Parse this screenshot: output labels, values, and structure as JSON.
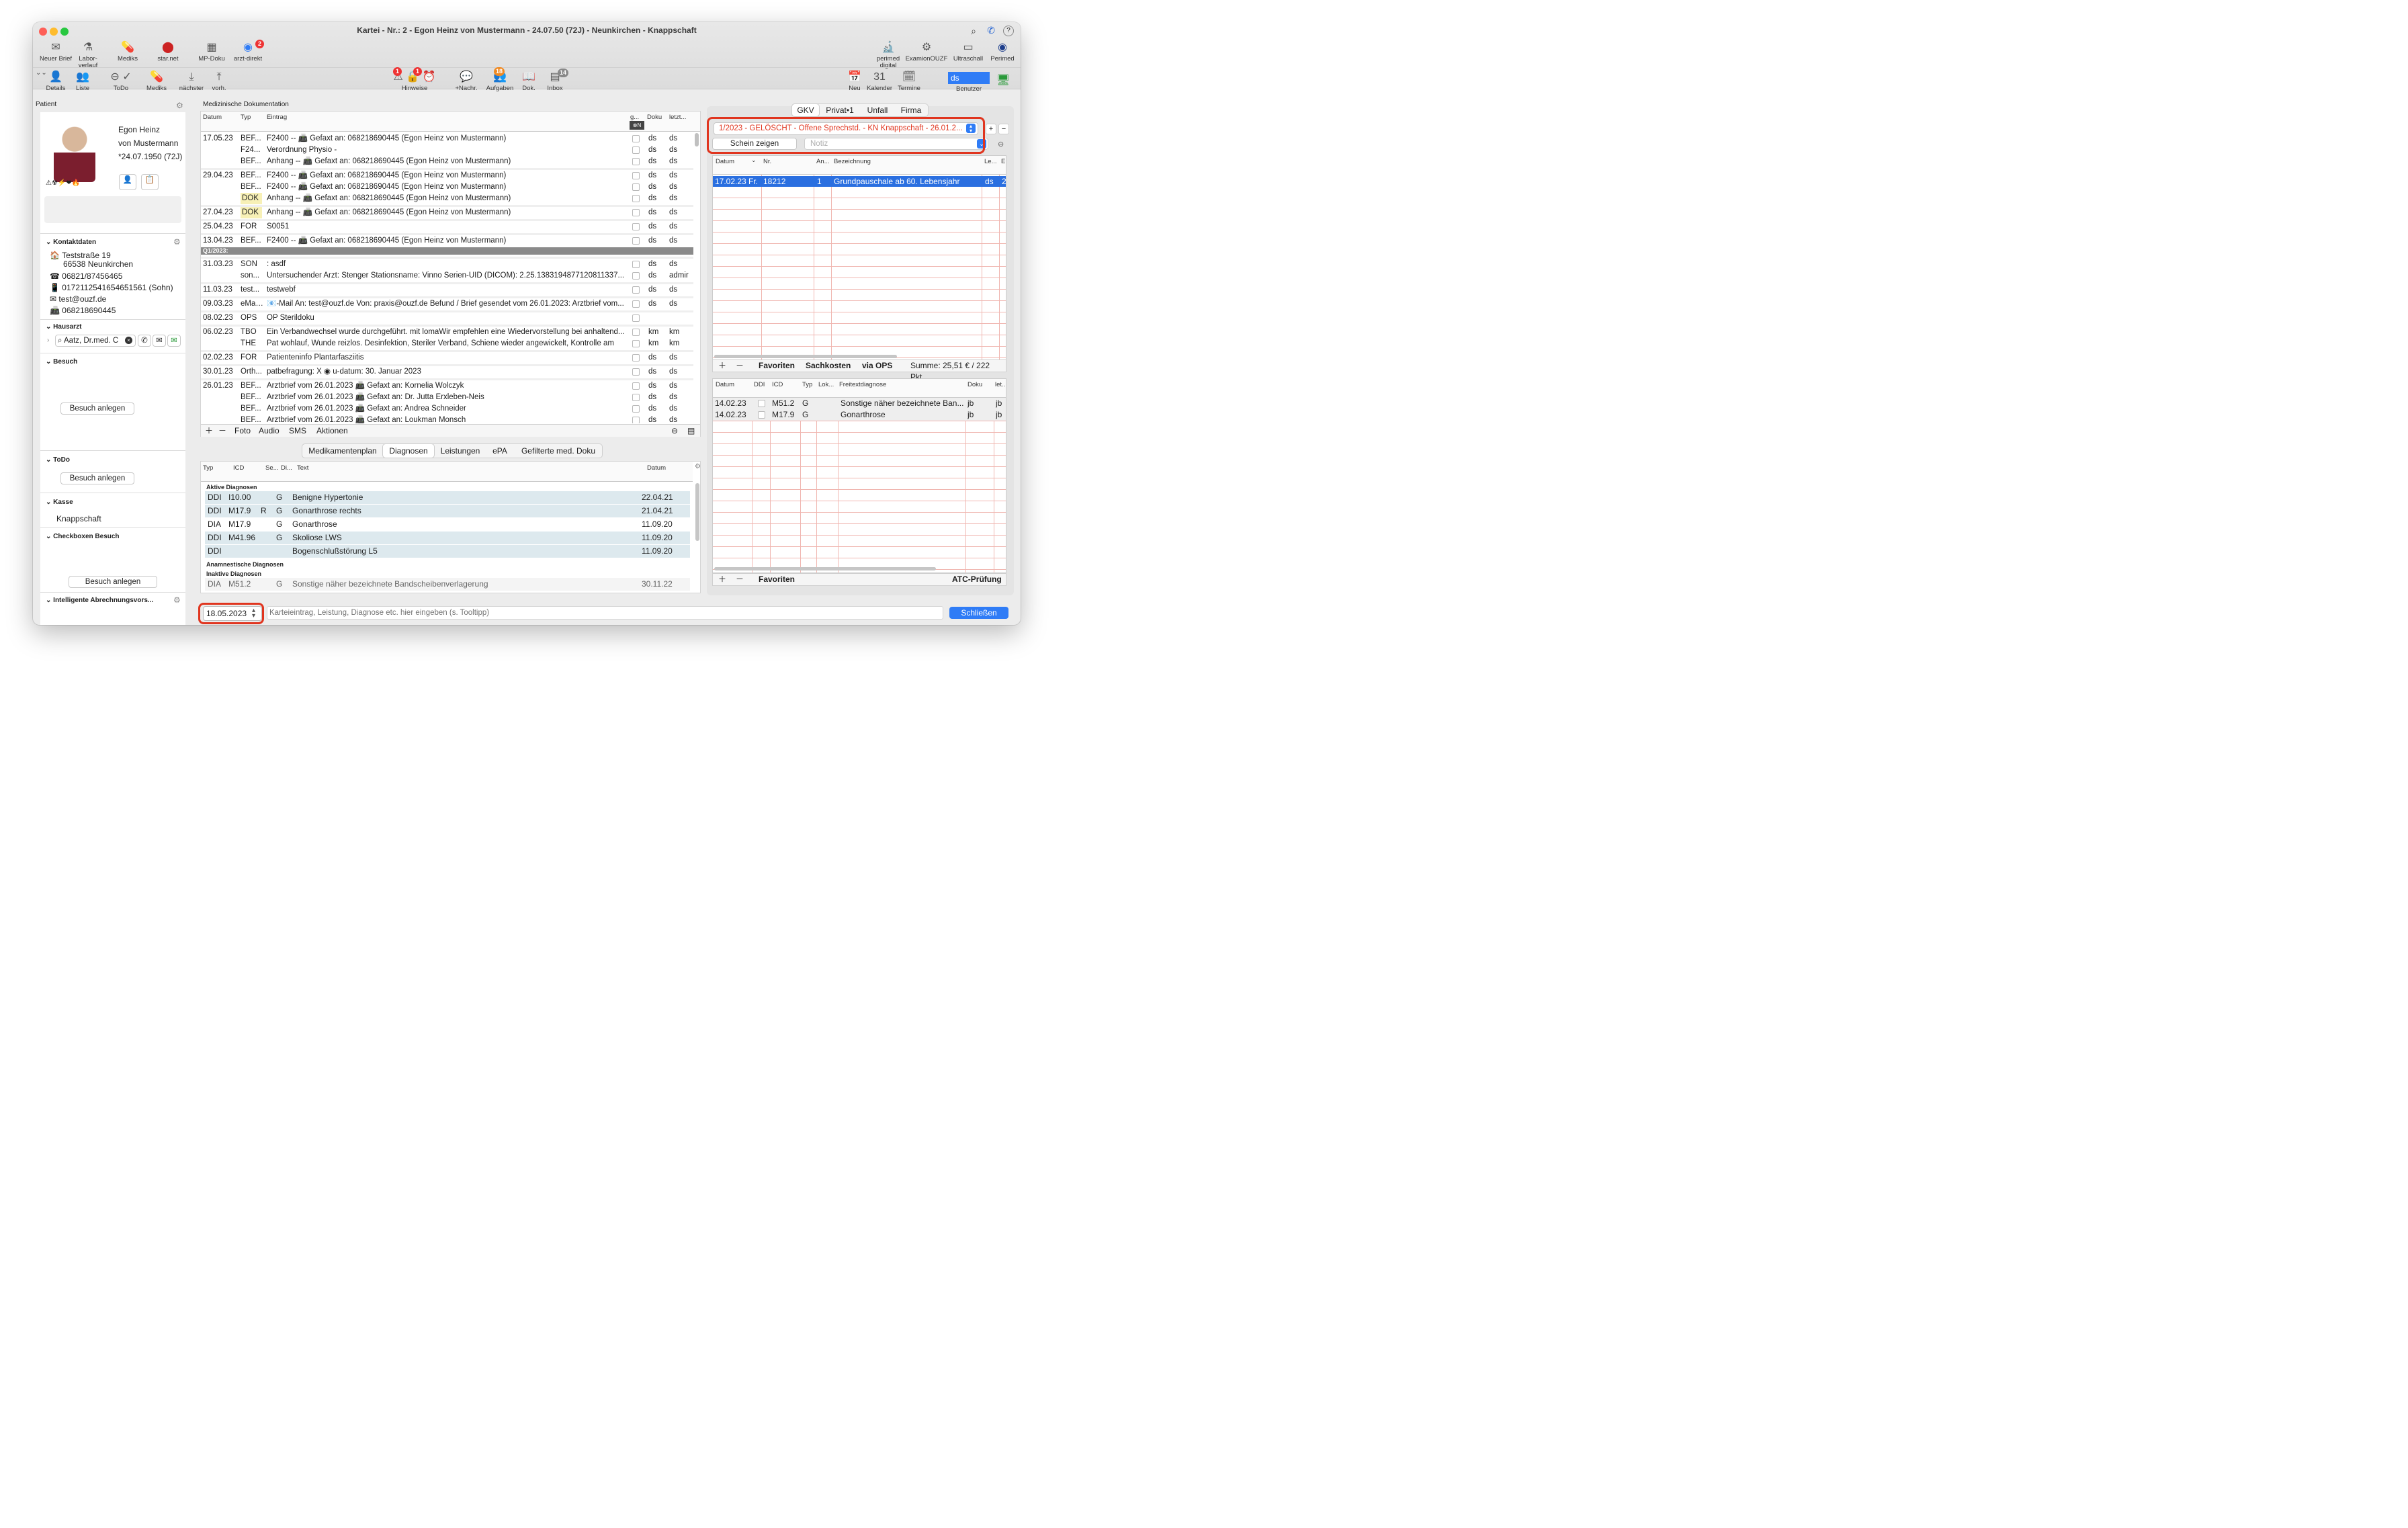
{
  "window": {
    "title": "Kartei - Nr.: 2 - Egon Heinz von Mustermann - 24.07.50 (72J) - Neunkirchen - Knappschaft"
  },
  "toolbar_top": {
    "items": [
      {
        "label": "Neuer Brief"
      },
      {
        "label": "Labor-\nverlauf"
      },
      {
        "label": "Mediks"
      },
      {
        "label": "star.net"
      },
      {
        "label": "MP-Doku"
      },
      {
        "label": "arzt-direkt",
        "badge": "2"
      }
    ],
    "right_items": [
      {
        "label": "perimed\ndigital"
      },
      {
        "label": "ExamionOUZF"
      },
      {
        "label": "Ultraschall"
      },
      {
        "label": "Perimed"
      }
    ]
  },
  "toolbar_bottom": {
    "items": [
      {
        "label": "Details"
      },
      {
        "label": "Liste"
      },
      {
        "label": "ToDo"
      },
      {
        "label": "Mediks"
      },
      {
        "label": "nächster"
      },
      {
        "label": "vorh."
      },
      {
        "label": "Hinweise",
        "badge1": "1",
        "badge2": "1"
      },
      {
        "label": "+Nachr."
      },
      {
        "label": "Aufgaben",
        "badge": "18"
      },
      {
        "label": "Dok."
      },
      {
        "label": "Inbox",
        "badge": "14"
      }
    ],
    "right_items": [
      {
        "label": "Neu"
      },
      {
        "label": "Kalender"
      },
      {
        "label": "Termine"
      }
    ],
    "calendar_day": "31",
    "user_field": "ds",
    "user_label": "Benutzer"
  },
  "patient": {
    "panel_title": "Patient",
    "name_line1": "Egon Heinz",
    "name_line2": "von Mustermann",
    "birth": "*24.07.1950 (72J)",
    "contact": {
      "title": "Kontaktdaten",
      "street": "Teststraße 19",
      "city": "66538 Neunkirchen",
      "phone": "06821/87456465",
      "mobile": "0172112541654651561 (Sohn)",
      "email": "test@ouzf.de",
      "fax": "068218690445"
    },
    "hausarzt": {
      "title": "Hausarzt",
      "value": "Aatz, Dr.med. C"
    },
    "besuch": {
      "title": "Besuch",
      "button": "Besuch anlegen"
    },
    "todo": {
      "title": "ToDo",
      "button": "Besuch anlegen"
    },
    "kasse": {
      "title": "Kasse",
      "value": "Knappschaft"
    },
    "checkboxen": {
      "title": "Checkboxen Besuch",
      "button": "Besuch anlegen"
    },
    "abrechnung": {
      "title": "Intelligente Abrechnungsvors..."
    }
  },
  "doku": {
    "title": "Medizinische Dokumentation",
    "headers": {
      "datum": "Datum",
      "typ": "Typ",
      "eintrag": "Eintrag",
      "g": "g...",
      "doku": "Doku",
      "letzt": "letzt..."
    },
    "rows": [
      {
        "date": "17.05.23",
        "typ": "BEF...",
        "text": "F2400 -- 📠 Gefaxt an:  068218690445 (Egon Heinz von Mustermann)",
        "doku": "ds",
        "letzt": "ds"
      },
      {
        "date": "",
        "typ": "F24...",
        "text": "Verordnung Physio -",
        "doku": "ds",
        "letzt": "ds"
      },
      {
        "date": "",
        "typ": "BEF...",
        "text": "Anhang -- 📠 Gefaxt an:  068218690445 (Egon Heinz von Mustermann)",
        "doku": "ds",
        "letzt": "ds"
      },
      {
        "date": "29.04.23",
        "typ": "BEF...",
        "text": "F2400 -- 📠 Gefaxt an:  068218690445 (Egon Heinz von Mustermann)",
        "doku": "ds",
        "letzt": "ds"
      },
      {
        "date": "",
        "typ": "BEF...",
        "text": "F2400 -- 📠 Gefaxt an:  068218690445 (Egon Heinz von Mustermann)",
        "doku": "ds",
        "letzt": "ds"
      },
      {
        "date": "",
        "typ": "DOK",
        "text": "Anhang -- 📠 Gefaxt an:  068218690445 (Egon Heinz von Mustermann)",
        "doku": "ds",
        "letzt": "ds",
        "hl": true
      },
      {
        "date": "27.04.23",
        "typ": "DOK",
        "text": "Anhang -- 📠 Gefaxt an:  068218690445 (Egon Heinz von Mustermann)",
        "doku": "ds",
        "letzt": "ds",
        "hl": true
      },
      {
        "date": "25.04.23",
        "typ": "FOR",
        "text": "S0051",
        "doku": "ds",
        "letzt": "ds"
      },
      {
        "date": "13.04.23",
        "typ": "BEF...",
        "text": "F2400 -- 📠 Gefaxt an:  068218690445 (Egon Heinz von Mustermann)",
        "doku": "ds",
        "letzt": "ds"
      },
      {
        "quarter": "Q1/2023:"
      },
      {
        "date": "31.03.23",
        "typ": "SON",
        "text": " : asdf",
        "doku": "ds",
        "letzt": "ds"
      },
      {
        "date": "",
        "typ": "son...",
        "text": "Untersuchender Arzt: Stenger Stationsname: Vinno Serien-UID (DICOM): 2.25.1383194877120811337...",
        "doku": "ds",
        "letzt": "admir"
      },
      {
        "date": "11.03.23",
        "typ": "test...",
        "text": "testwebf",
        "doku": "ds",
        "letzt": "ds"
      },
      {
        "date": "09.03.23",
        "typ": "eMai...",
        "text": "📧-Mail An: test@ouzf.de Von: praxis@ouzf.de Befund / Brief gesendet vom 26.01.2023: Arztbrief vom...",
        "doku": "ds",
        "letzt": "ds"
      },
      {
        "date": "08.02.23",
        "typ": "OPS",
        "text": "OP Sterildoku",
        "doku": "",
        "letzt": ""
      },
      {
        "date": "06.02.23",
        "typ": "TBO",
        "text": "Ein Verbandwechsel wurde durchgeführt. mit lomaWir empfehlen eine Wiedervorstellung bei anhaltend...",
        "doku": "km",
        "letzt": "km"
      },
      {
        "date": "",
        "typ": "THE",
        "text": "Pat wohlauf, Wunde reizlos. Desinfektion, Steriler Verband, Schiene wieder angewickelt, Kontrolle am",
        "doku": "km",
        "letzt": "km"
      },
      {
        "date": "02.02.23",
        "typ": "FOR",
        "text": "Patienteninfo Plantarfasziitis",
        "doku": "ds",
        "letzt": "ds"
      },
      {
        "date": "30.01.23",
        "typ": "Orth...",
        "text": "patbefragung: X  ◉ u-datum: 30. Januar 2023",
        "doku": "ds",
        "letzt": "ds"
      },
      {
        "date": "26.01.23",
        "typ": "BEF...",
        "text": "Arztbrief vom 26.01.2023 📠 Gefaxt an: Kornelia Wolczyk",
        "doku": "ds",
        "letzt": "ds"
      },
      {
        "date": "",
        "typ": "BEF...",
        "text": "Arztbrief vom 26.01.2023 📠 Gefaxt an: Dr. Jutta Erxleben-Neis",
        "doku": "ds",
        "letzt": "ds"
      },
      {
        "date": "",
        "typ": "BEF...",
        "text": "Arztbrief vom 26.01.2023 📠 Gefaxt an: Andrea Schneider",
        "doku": "ds",
        "letzt": "ds"
      },
      {
        "date": "",
        "typ": "BEF...",
        "text": "Arztbrief vom 26.01.2023 📠 Gefaxt an: Loukman Monsch",
        "doku": "ds",
        "letzt": "ds"
      }
    ],
    "bottom_tabs": [
      "Foto",
      "Audio",
      "SMS",
      "Aktionen"
    ]
  },
  "lower_tabs": [
    "Medikamentenplan",
    "Diagnosen",
    "Leistungen",
    "ePA",
    "Gefilterte med. Doku"
  ],
  "lower_tabs_active": "Diagnosen",
  "diagnosen": {
    "headers": {
      "typ": "Typ",
      "icd": "ICD",
      "se": "Se...",
      "di": "Di...",
      "text": "Text",
      "datum": "Datum"
    },
    "group_active": "Aktive Diagnosen",
    "active": [
      {
        "typ": "DDI",
        "icd": "I10.00",
        "se": "",
        "di": "G",
        "text": "Benigne Hypertonie",
        "datum": "22.04.21"
      },
      {
        "typ": "DDI",
        "icd": "M17.9",
        "se": "R",
        "di": "G",
        "text": "Gonarthrose rechts",
        "datum": "21.04.21"
      },
      {
        "typ": "DIA",
        "icd": "M17.9",
        "se": "",
        "di": "G",
        "text": "Gonarthrose",
        "datum": "11.09.20"
      },
      {
        "typ": "DDI",
        "icd": "M41.96",
        "se": "",
        "di": "G",
        "text": "Skoliose LWS",
        "datum": "11.09.20"
      },
      {
        "typ": "DDI",
        "icd": "",
        "se": "",
        "di": "",
        "text": "Bogenschlußstörung L5",
        "datum": "11.09.20"
      }
    ],
    "group_anam": "Anamnestische Diagnosen",
    "group_inactive": "Inaktive Diagnosen",
    "inactive": [
      {
        "typ": "DIA",
        "icd": "M51.2",
        "se": "",
        "di": "G",
        "text": "Sonstige näher bezeichnete Bandscheibenverlagerung",
        "datum": "30.11.22"
      }
    ]
  },
  "entry": {
    "date": "18.05.2023",
    "placeholder": "Karteieintrag, Leistung, Diagnose etc. hier eingeben (s. Tooltipp)",
    "close": "Schließen"
  },
  "right": {
    "tabs": [
      "GKV",
      "Privat•1",
      "Unfall",
      "Firma"
    ],
    "tabs_active": "GKV",
    "schein": "1/2023 - GELÖSCHT - Offene Sprechstd. - KN Knappschaft - 26.01.2...",
    "schein_zeigen": "Schein zeigen",
    "notiz_placeholder": "Notiz",
    "leist_headers": {
      "datum": "Datum",
      "nr": "Nr.",
      "an": "An...",
      "bez": "Bezeichnung",
      "le": "Le...",
      "eu": "Eu"
    },
    "leistungen": [
      {
        "datum": "17.02.23",
        "tag": "Fr.",
        "nr": "18212",
        "an": "1",
        "bez": "Grundpauschale ab 60. Lebensjahr",
        "le": "ds",
        "eu": "2"
      }
    ],
    "leist_footer": {
      "favoriten": "Favoriten",
      "sachkosten": "Sachkosten",
      "ops": "via OPS",
      "summe": "Summe: 25,51 € / 222 Pkt."
    },
    "diag_headers": {
      "datum": "Datum",
      "ddi": "DDI",
      "icd": "ICD",
      "typ": "Typ",
      "lok": "Lok...",
      "frei": "Freitextdiagnose",
      "doku": "Doku",
      "let": "let..."
    },
    "diagnosen": [
      {
        "datum": "14.02.23",
        "icd": "M51.2",
        "typ": "G",
        "frei": "Sonstige näher bezeichnete Ban...",
        "doku": "jb",
        "let": "jb"
      },
      {
        "datum": "14.02.23",
        "icd": "M17.9",
        "typ": "G",
        "frei": "Gonarthrose",
        "doku": "jb",
        "let": "jb"
      }
    ],
    "diag_footer": {
      "favoriten": "Favoriten",
      "atc": "ATC-Prüfung"
    }
  },
  "colors": {
    "accent": "#2f7cf6",
    "warn": "#e0351f",
    "selection": "#2a6fe0"
  }
}
